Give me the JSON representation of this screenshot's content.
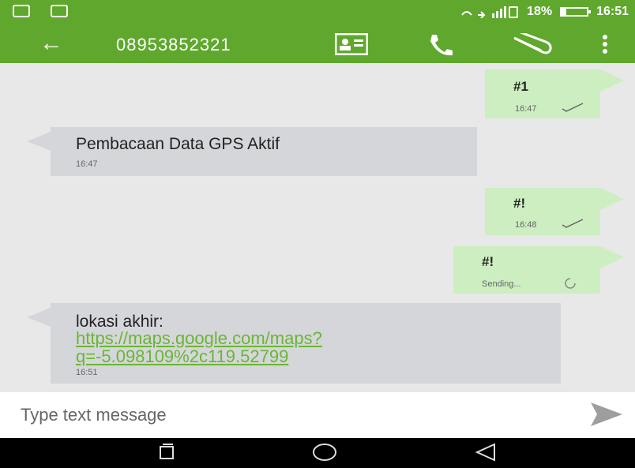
{
  "status_bar": {
    "time": "16:51",
    "battery": "18%",
    "battery_level": 0.18
  },
  "app_bar": {
    "contact_number": "08953852321"
  },
  "messages": [
    {
      "direction": "out",
      "text": "#1",
      "time": "16:47",
      "status": "sent"
    },
    {
      "direction": "in",
      "text": "Pembacaan Data GPS Aktif",
      "time": "16:47"
    },
    {
      "direction": "out",
      "text": "#!",
      "time": "16:48",
      "status": "sent"
    },
    {
      "direction": "out",
      "text": "#!",
      "time": "Sending...",
      "status": "sending"
    },
    {
      "direction": "in",
      "text": "lokasi akhir:",
      "link": "https://maps.google.com/maps?q=-5.098109%2c119.52799",
      "link_line1": "https://maps.google.com/maps?",
      "link_line2": "q=-5.098109%2c119.52799",
      "time": "16:51"
    }
  ],
  "composer": {
    "placeholder": "Type text message"
  },
  "colors": {
    "accent": "#5fa82d",
    "outgoing_bubble": "#cdeec1",
    "incoming_bubble": "#d4d6d9",
    "link": "#6ab633"
  }
}
